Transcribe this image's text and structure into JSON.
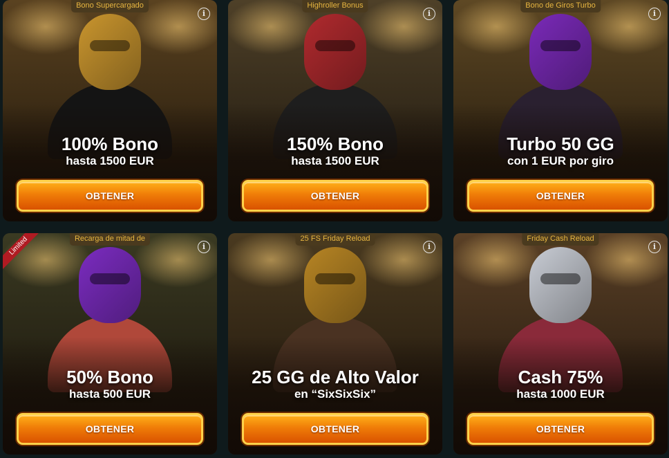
{
  "cards": [
    {
      "tag": "Bono Supercargado",
      "title": "100% Bono",
      "subtitle": "hasta 1500 EUR",
      "button": "OBTENER",
      "info_icon": "i",
      "theme": {
        "bg_top": "#5a4220",
        "bg_bottom": "#1c140a",
        "skin": "#c9952e",
        "suit": "#141414"
      }
    },
    {
      "tag": "Highroller Bonus",
      "title": "150% Bono",
      "subtitle": "hasta 1500 EUR",
      "button": "OBTENER",
      "info_icon": "i",
      "theme": {
        "bg_top": "#4e4028",
        "bg_bottom": "#1a140c",
        "skin": "#b02a2e",
        "suit": "#1e1e1e"
      }
    },
    {
      "tag": "Bono de Giros Turbo",
      "title": "Turbo 50 GG",
      "subtitle": "con 1 EUR por giro",
      "button": "OBTENER",
      "info_icon": "i",
      "theme": {
        "bg_top": "#5e4824",
        "bg_bottom": "#1c140a",
        "skin": "#7a2ab8",
        "suit": "#2a2030"
      }
    },
    {
      "tag": "Recarga de mitad de",
      "ribbon": "Limited",
      "title": "50% Bono",
      "subtitle": "hasta 500 EUR",
      "button": "OBTENER",
      "info_icon": "i",
      "theme": {
        "bg_top": "#3a3a22",
        "bg_bottom": "#18120a",
        "skin": "#7b2cc0",
        "suit": "#b0483a"
      }
    },
    {
      "tag": "25 FS Friday Reload",
      "title": "25 GG de Alto Valor",
      "subtitle": "en “SixSixSix”",
      "button": "OBTENER",
      "info_icon": "i",
      "theme": {
        "bg_top": "#4a3a20",
        "bg_bottom": "#1a120a",
        "skin": "#b78524",
        "suit": "#4a3222"
      }
    },
    {
      "tag": "Friday Cash Reload",
      "title": "Cash 75%",
      "subtitle": "hasta 1000 EUR",
      "button": "OBTENER",
      "info_icon": "i",
      "theme": {
        "bg_top": "#5a4026",
        "bg_bottom": "#1c130b",
        "skin": "#c8ccd4",
        "suit": "#8a2a3a"
      }
    }
  ],
  "colors": {
    "page_bg": "#0f1a1c",
    "tag_bg": "#4a3a1e",
    "tag_text": "#e8b640",
    "button_gradient_top": "#ffb01a",
    "button_gradient_bottom": "#d95200",
    "button_border": "#ffd24a",
    "ribbon": "#b01b22"
  }
}
